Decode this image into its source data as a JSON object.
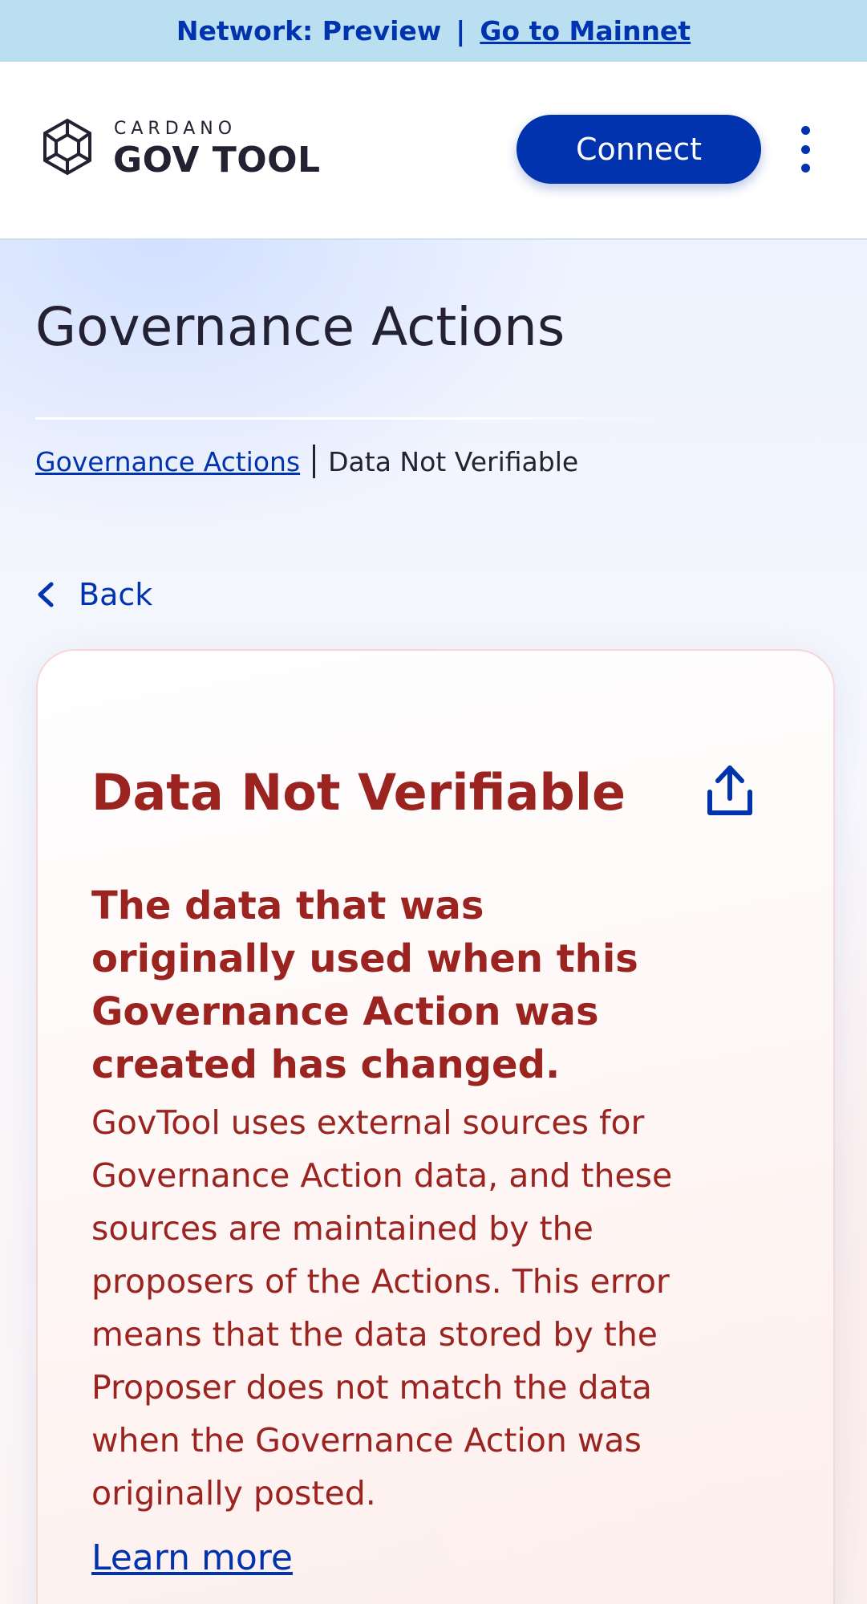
{
  "network_bar": {
    "label": "Network: Preview",
    "separator": "|",
    "link": "Go to Mainnet"
  },
  "header": {
    "logo_small": "CARDANO",
    "logo_big": "GOV TOOL",
    "connect_label": "Connect",
    "menu_icon": "kebab-menu-icon"
  },
  "page": {
    "title": "Governance Actions",
    "breadcrumb": {
      "parent": "Governance Actions",
      "current": "Data Not Verifiable"
    },
    "back_label": "Back"
  },
  "card": {
    "title": "Data Not Verifiable",
    "share_icon": "share-icon",
    "subtitle": "The data that was originally used when this Governance Action was created has changed.",
    "body": "GovTool uses external sources for Governance Action data, and these sources are maintained by the proposers of the Actions. This error means that the data stored by the Proposer does not match the data when the Governance Action was originally posted.",
    "learn_more": "Learn more"
  },
  "colors": {
    "brand_blue": "#0033ad",
    "error_red": "#9b2320",
    "network_bar_bg": "#b9dff0"
  }
}
